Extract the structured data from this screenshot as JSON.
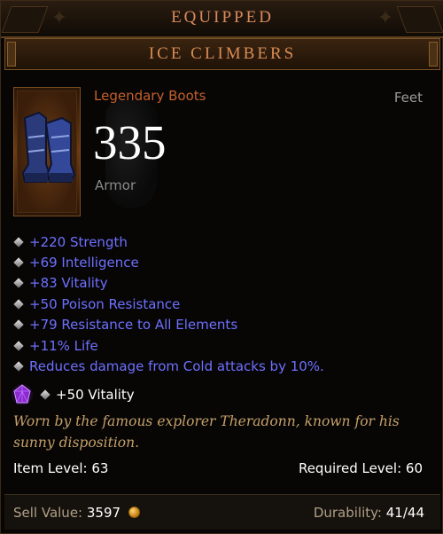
{
  "header": {
    "equipped_label": "EQUIPPED",
    "item_name": "ICE CLIMBERS"
  },
  "item": {
    "type": "Legendary Boots",
    "slot": "Feet",
    "armor_value": "335",
    "armor_label": "Armor",
    "icon": "boots-icon"
  },
  "affixes": [
    "+220 Strength",
    "+69 Intelligence",
    "+83 Vitality",
    "+50 Poison Resistance",
    "+79 Resistance to All Elements",
    "+11% Life",
    "Reduces damage from Cold attacks by 10%."
  ],
  "socket": {
    "gem_icon": "amethyst-gem-icon",
    "text": "+50 Vitality"
  },
  "flavor": "Worn by the famous explorer Theradonn, known for his sunny disposition.",
  "levels": {
    "item_level": "Item Level: 63",
    "required_level": "Required Level: 60"
  },
  "footer": {
    "sell_label": "Sell Value:",
    "sell_value": "3597",
    "durability_label": "Durability:",
    "durability_value": "41/44"
  },
  "colors": {
    "legendary": "#c4602c",
    "magic_affix": "#6e70ff",
    "flavor": "#c6a06a",
    "header_text": "#d98a5c"
  }
}
